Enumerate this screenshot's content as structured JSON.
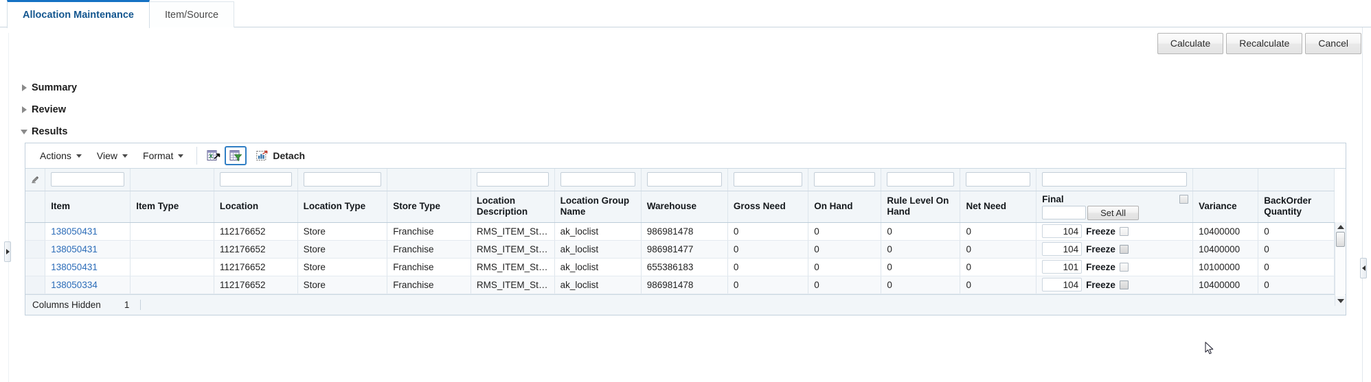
{
  "tabs": [
    {
      "label": "Allocation Maintenance",
      "active": true
    },
    {
      "label": "Item/Source",
      "active": false
    }
  ],
  "actions": {
    "calculate": "Calculate",
    "recalculate": "Recalculate",
    "cancel": "Cancel"
  },
  "sections": [
    {
      "label": "Summary",
      "expanded": false
    },
    {
      "label": "Review",
      "expanded": false
    },
    {
      "label": "Results",
      "expanded": true
    }
  ],
  "table_toolbar": {
    "actions_menu": "Actions",
    "view_menu": "View",
    "format_menu": "Format",
    "export_icon": "export-to-excel-icon",
    "query_by_example_icon": "query-by-example-icon",
    "detach_icon": "detach-icon",
    "detach_label": "Detach"
  },
  "grid": {
    "columns": [
      {
        "key": "item",
        "label": "Item"
      },
      {
        "key": "item_type",
        "label": "Item Type"
      },
      {
        "key": "location",
        "label": "Location"
      },
      {
        "key": "location_type",
        "label": "Location Type"
      },
      {
        "key": "store_type",
        "label": "Store Type"
      },
      {
        "key": "location_description",
        "label": "Location Description"
      },
      {
        "key": "location_group_name",
        "label": "Location Group Name"
      },
      {
        "key": "warehouse",
        "label": "Warehouse"
      },
      {
        "key": "gross_need",
        "label": "Gross Need"
      },
      {
        "key": "on_hand",
        "label": "On Hand"
      },
      {
        "key": "rule_level_on_hand",
        "label": "Rule Level On Hand"
      },
      {
        "key": "net_need",
        "label": "Net Need"
      },
      {
        "key": "final",
        "label": "Final"
      },
      {
        "key": "variance",
        "label": "Variance"
      },
      {
        "key": "backorder_quantity",
        "label": "BackOrder Quantity"
      }
    ],
    "final_header": {
      "label": "Final",
      "set_all_label": "Set All",
      "set_all_value": "",
      "select_all_checked": false
    },
    "freeze_label": "Freeze",
    "qbe_placeholder": "",
    "qbe_values": {
      "item": "",
      "location": "",
      "location_type": "",
      "location_description": "",
      "location_group_name": "",
      "warehouse": "",
      "gross_need": "",
      "on_hand": "",
      "rule_level_on_hand": "",
      "net_need": "",
      "final": ""
    },
    "rows": [
      {
        "item": "138050431",
        "item_type": "",
        "location": "112176652",
        "location_type": "Store",
        "store_type": "Franchise",
        "location_description": "RMS_ITEM_Sto...",
        "location_group_name": "ak_loclist",
        "warehouse": "986981478",
        "gross_need": "0",
        "on_hand": "0",
        "rule_level_on_hand": "0",
        "net_need": "0",
        "final": "104",
        "freeze": false,
        "variance": "10400000",
        "backorder_quantity": "0"
      },
      {
        "item": "138050431",
        "item_type": "",
        "location": "112176652",
        "location_type": "Store",
        "store_type": "Franchise",
        "location_description": "RMS_ITEM_Sto...",
        "location_group_name": "ak_loclist",
        "warehouse": "986981477",
        "gross_need": "0",
        "on_hand": "0",
        "rule_level_on_hand": "0",
        "net_need": "0",
        "final": "104",
        "freeze": true,
        "variance": "10400000",
        "backorder_quantity": "0"
      },
      {
        "item": "138050431",
        "item_type": "",
        "location": "112176652",
        "location_type": "Store",
        "store_type": "Franchise",
        "location_description": "RMS_ITEM_Sto...",
        "location_group_name": "ak_loclist",
        "warehouse": "655386183",
        "gross_need": "0",
        "on_hand": "0",
        "rule_level_on_hand": "0",
        "net_need": "0",
        "final": "101",
        "freeze": false,
        "variance": "10100000",
        "backorder_quantity": "0"
      },
      {
        "item": "138050334",
        "item_type": "",
        "location": "112176652",
        "location_type": "Store",
        "store_type": "Franchise",
        "location_description": "RMS_ITEM_Sto...",
        "location_group_name": "ak_loclist",
        "warehouse": "986981478",
        "gross_need": "0",
        "on_hand": "0",
        "rule_level_on_hand": "0",
        "net_need": "0",
        "final": "104",
        "freeze": true,
        "variance": "10400000",
        "backorder_quantity": "0"
      }
    ]
  },
  "footer": {
    "columns_hidden_label": "Columns Hidden",
    "columns_hidden_count": "1"
  },
  "colors": {
    "tab_active": "#13568f",
    "tab_accent": "#1572c4",
    "link": "#2b6cb8",
    "header_bg": "#f2f6f9",
    "panel_border": "#c2d0dc",
    "selected_icon_border": "#2f7ec4"
  }
}
